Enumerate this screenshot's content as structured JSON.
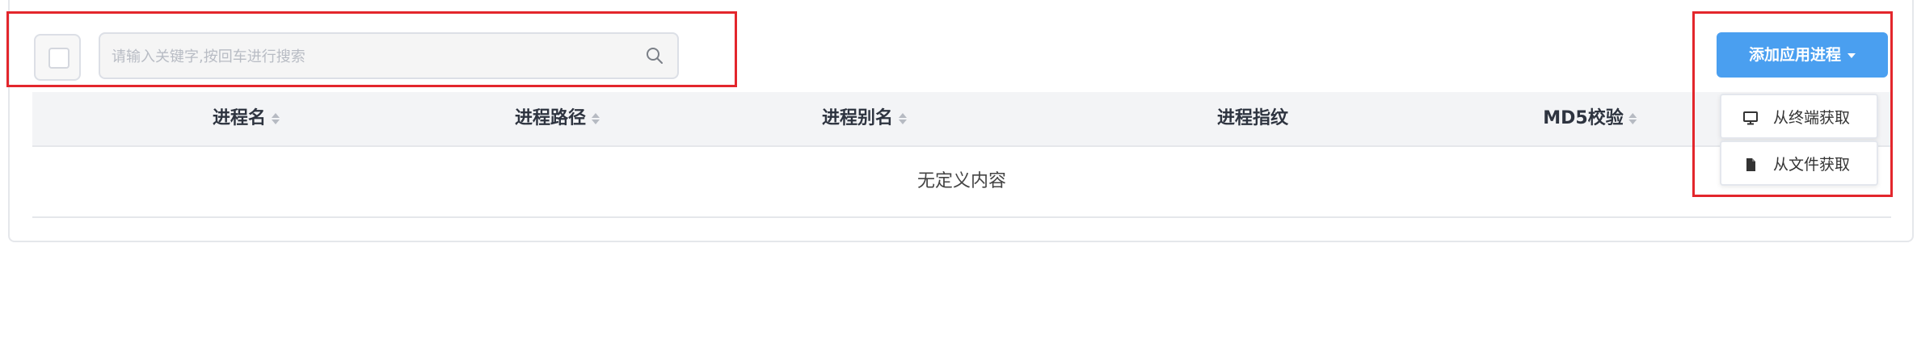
{
  "toolbar": {
    "search_placeholder": "请输入关键字,按回车进行搜索",
    "search_value": "",
    "add_button_label": "添加应用进程"
  },
  "add_menu": {
    "items": [
      {
        "label": "从终端获取",
        "icon": "monitor-icon"
      },
      {
        "label": "从文件获取",
        "icon": "file-icon"
      }
    ]
  },
  "table": {
    "columns": [
      {
        "label": "进程名",
        "sortable": true
      },
      {
        "label": "进程路径",
        "sortable": true
      },
      {
        "label": "进程别名",
        "sortable": true
      },
      {
        "label": "进程指纹",
        "sortable": false
      },
      {
        "label": "MD5校验",
        "sortable": true
      }
    ],
    "empty_text": "无定义内容"
  },
  "colors": {
    "primary": "#4a9ff0",
    "highlight": "#e3262c",
    "header_bg": "#f3f4f6"
  }
}
